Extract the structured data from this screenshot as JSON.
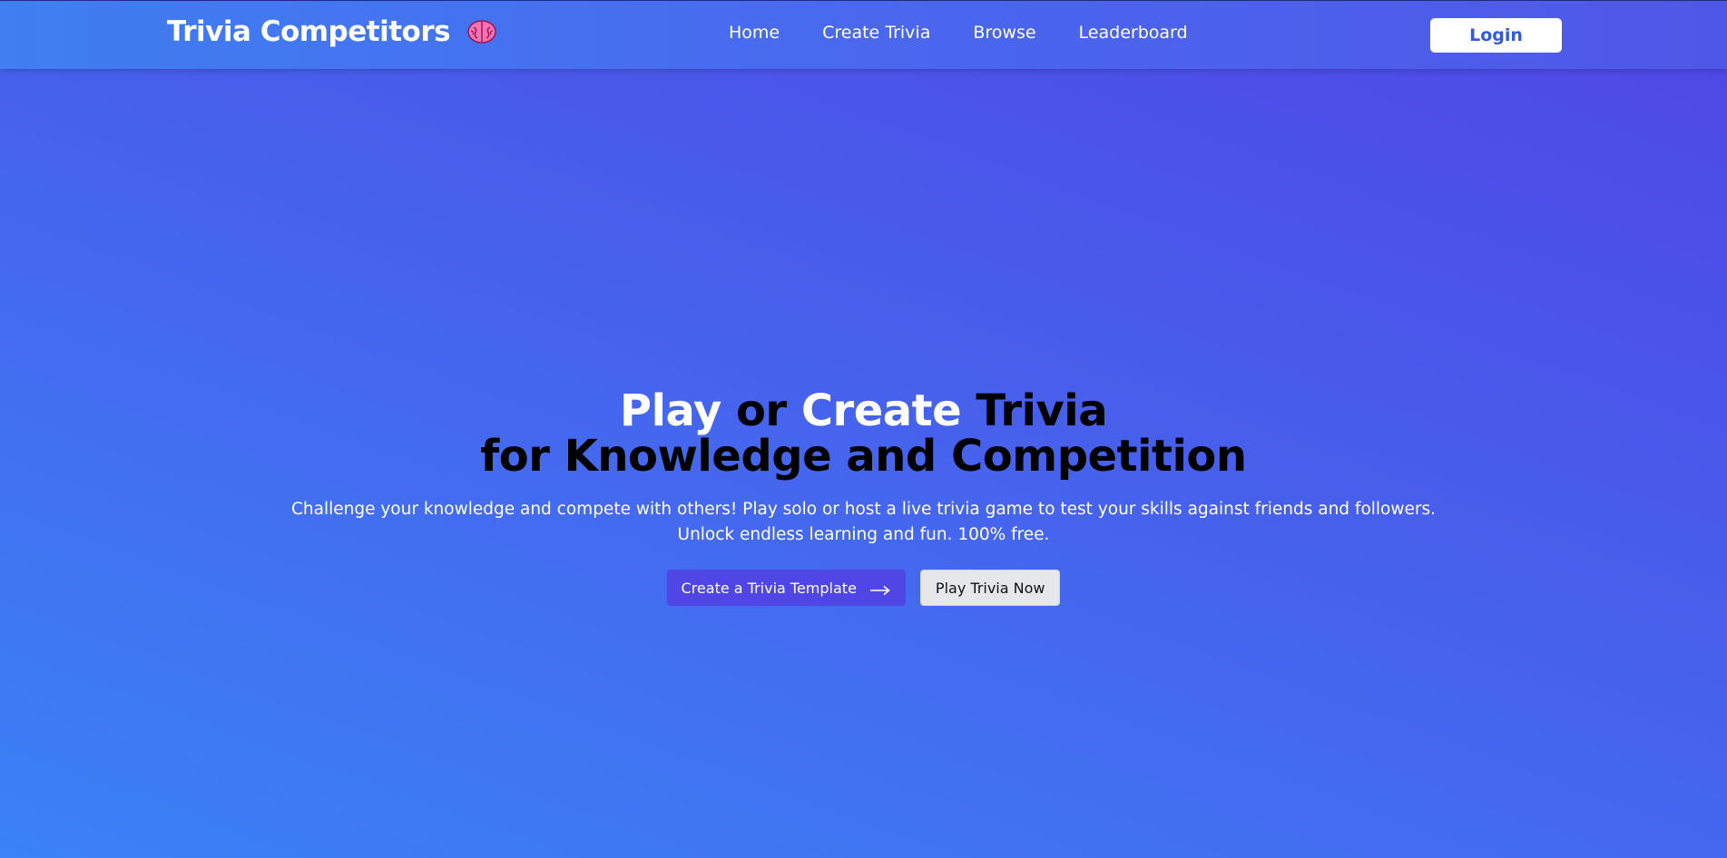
{
  "header": {
    "brand": "Trivia Competitors",
    "brand_icon": "brain-icon",
    "nav": [
      {
        "label": "Home"
      },
      {
        "label": "Create Trivia"
      },
      {
        "label": "Browse"
      },
      {
        "label": "Leaderboard"
      }
    ],
    "login_label": "Login"
  },
  "hero": {
    "title_line1": {
      "part1": "Play",
      "part2": " or ",
      "part3": "Create",
      "part4": " Trivia"
    },
    "title_line2": "for Knowledge and Competition",
    "description_line1": "Challenge your knowledge and compete with others! Play solo or host a live trivia game to test your skills against friends and followers.",
    "description_line2": "Unlock endless learning and fun. 100% free.",
    "primary_cta": "Create a Trivia Template",
    "primary_cta_icon": "arrow-right-icon",
    "secondary_cta": "Play Trivia Now"
  },
  "colors": {
    "accent": "#4f46e5",
    "background_start": "#3b82f6",
    "background_end": "#4f46e5",
    "login_text": "#2f5ae0"
  }
}
